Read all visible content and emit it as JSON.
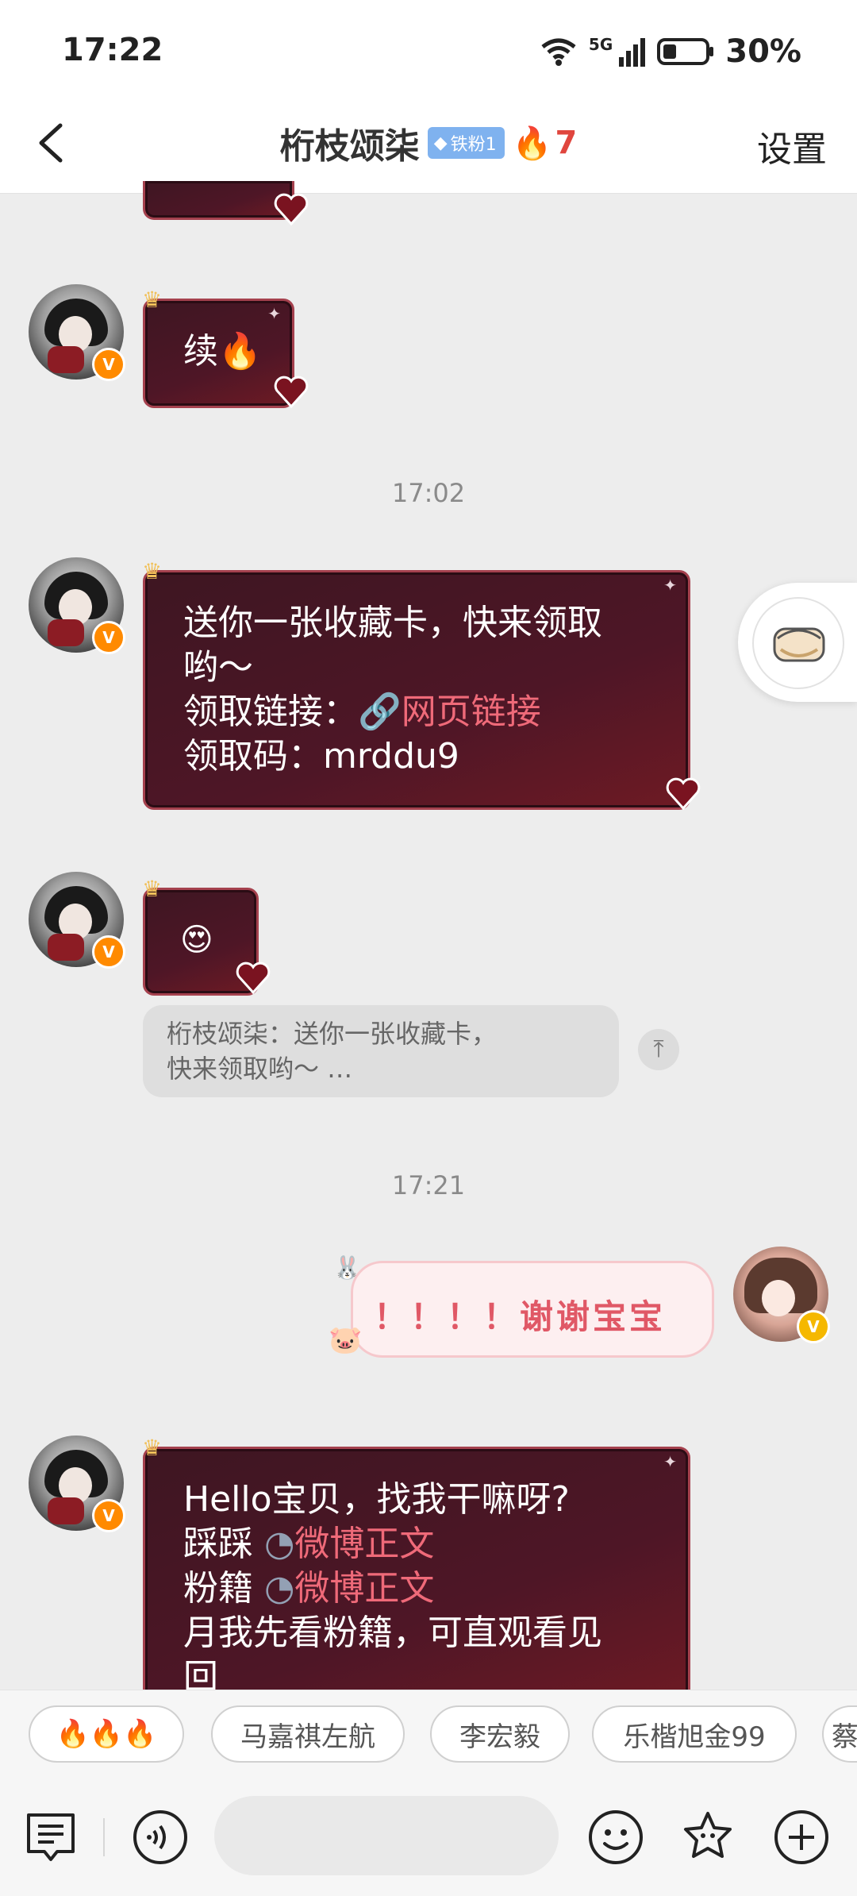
{
  "status": {
    "time": "17:22",
    "network": "5G",
    "battery": "30%"
  },
  "header": {
    "title": "桁枝颂柒",
    "fan_badge": "铁粉1",
    "streak_count": "7",
    "settings": "设置"
  },
  "messages": {
    "m1_text": "续🔥",
    "time1": "17:02",
    "m2_line1": "送你一张收藏卡，快来领取",
    "m2_line2": "哟～",
    "m2_line3_prefix": "领取链接：",
    "m2_link": "网页链接",
    "m2_line4": "领取码：mrddu9",
    "m3_emoji": "😍",
    "quote_line1": "桁枝颂柒：送你一张收藏卡，",
    "quote_line2": "快来领取哟～ …",
    "time2": "17:21",
    "m4_text": "！！！！谢谢宝宝",
    "m5_line1": "Hello宝贝，找我干嘛呀?",
    "m5_line2_prefix": "踩踩 ",
    "m5_line2_link": "微博正文",
    "m5_line3_prefix": "粉籍 ",
    "m5_line3_link": "微博正文",
    "m5_line4": "月我先看粉籍，可直观看见",
    "m5_line5": "回"
  },
  "quick_replies": [
    "🔥🔥🔥",
    "马嘉祺左航",
    "李宏毅",
    "乐楷旭金99",
    "蔡"
  ],
  "input": {
    "placeholder": ""
  },
  "colors": {
    "bubble_dark": "#4e1626",
    "link": "#ef6a79",
    "pink_text": "#e05866",
    "badge_blue": "#7fb2ef",
    "v_orange": "#ff8a00",
    "v_gold": "#f5b800"
  },
  "icons": [
    "back-arrow-icon",
    "fire-icon",
    "link-icon",
    "weibo-icon",
    "crown-icon",
    "heart-icon",
    "scroll-top-icon",
    "notes-icon",
    "voice-icon",
    "smile-icon",
    "sticker-icon",
    "add-icon"
  ]
}
